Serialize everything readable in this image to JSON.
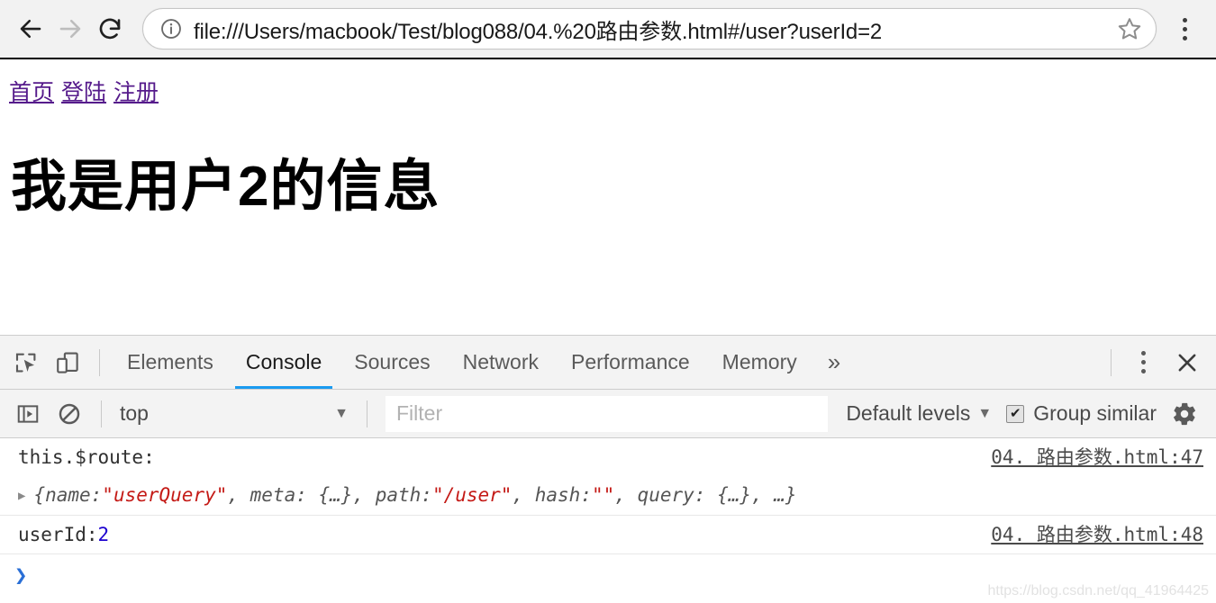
{
  "browser": {
    "back_label": "Back",
    "forward_label": "Forward",
    "reload_label": "Reload",
    "security_icon": "info-circle-icon",
    "url": "file:///Users/macbook/Test/blog088/04.%20路由参数.html#/user?userId=2",
    "bookmark_icon": "star-icon",
    "menu_icon": "kebab-menu-icon"
  },
  "page": {
    "nav_links": [
      {
        "label": "首页"
      },
      {
        "label": "登陆"
      },
      {
        "label": "注册"
      }
    ],
    "heading": "我是用户2的信息"
  },
  "devtools": {
    "inspect_icon": "inspect-element-icon",
    "device_icon": "device-toolbar-icon",
    "tabs": [
      {
        "label": "Elements",
        "active": false
      },
      {
        "label": "Console",
        "active": true
      },
      {
        "label": "Sources",
        "active": false
      },
      {
        "label": "Network",
        "active": false
      },
      {
        "label": "Performance",
        "active": false
      },
      {
        "label": "Memory",
        "active": false
      }
    ],
    "more_tabs_label": "»",
    "kebab_icon": "kebab-menu-icon",
    "close_icon": "close-icon",
    "active_tab_color": "#1a9bf0",
    "toolbar": {
      "sidebar_icon": "show-console-sidebar-icon",
      "clear_icon": "clear-console-icon",
      "context": "top",
      "context_caret": "▼",
      "filter_placeholder": "Filter",
      "filter_value": "",
      "levels_label": "Default levels",
      "levels_caret": "▼",
      "group_similar_label": "Group similar",
      "group_similar_checked": true,
      "group_similar_mark": "✔",
      "settings_icon": "gear-icon"
    },
    "console": {
      "messages": [
        {
          "label": "this.$route:",
          "source": "04. 路由参数.html:47",
          "expandable": true,
          "disclosure": "▶",
          "object_parts": [
            {
              "text": "{name: ",
              "type": "key"
            },
            {
              "text": "\"userQuery\"",
              "type": "string"
            },
            {
              "text": ", meta: {…}, path: ",
              "type": "key"
            },
            {
              "text": "\"/user\"",
              "type": "string"
            },
            {
              "text": ", hash: ",
              "type": "key"
            },
            {
              "text": "\"\"",
              "type": "string"
            },
            {
              "text": ", query: {…}, …}",
              "type": "key"
            }
          ]
        }
      ],
      "userid_message": {
        "label": "userId: ",
        "value": "2",
        "source": "04. 路由参数.html:48"
      },
      "prompt_chevron": "❯"
    }
  },
  "watermark": "https://blog.csdn.net/qq_41964425"
}
